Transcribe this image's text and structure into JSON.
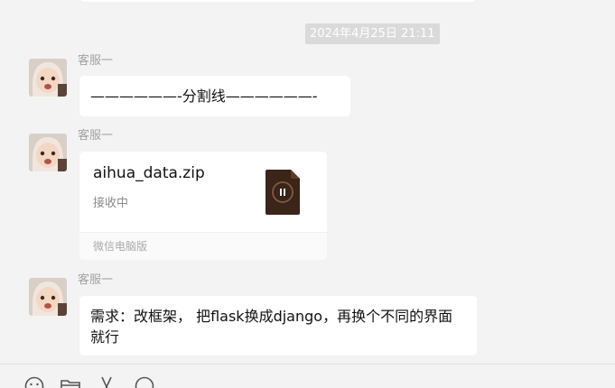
{
  "chat": {
    "timestamp": "2024年4月25日 21:11",
    "messages": [
      {
        "sender": "客服一",
        "type": "text",
        "text": "——————-分割线——————-"
      },
      {
        "sender": "客服一",
        "type": "file",
        "file_name": "aihua_data.zip",
        "status": "接收中",
        "source": "微信电脑版"
      },
      {
        "sender": "客服一",
        "type": "text",
        "text": "需求：改框架， 把flask换成django，再换个不同的界面就行"
      }
    ]
  },
  "toolbar": {
    "icons": [
      "emoji-icon",
      "folder-icon",
      "scissors-icon",
      "chat-history-icon"
    ]
  },
  "colors": {
    "background": "#f3f3f3",
    "bubble": "#ffffff",
    "file_icon": "#3b2418",
    "timestamp_bg": "#dadada"
  }
}
